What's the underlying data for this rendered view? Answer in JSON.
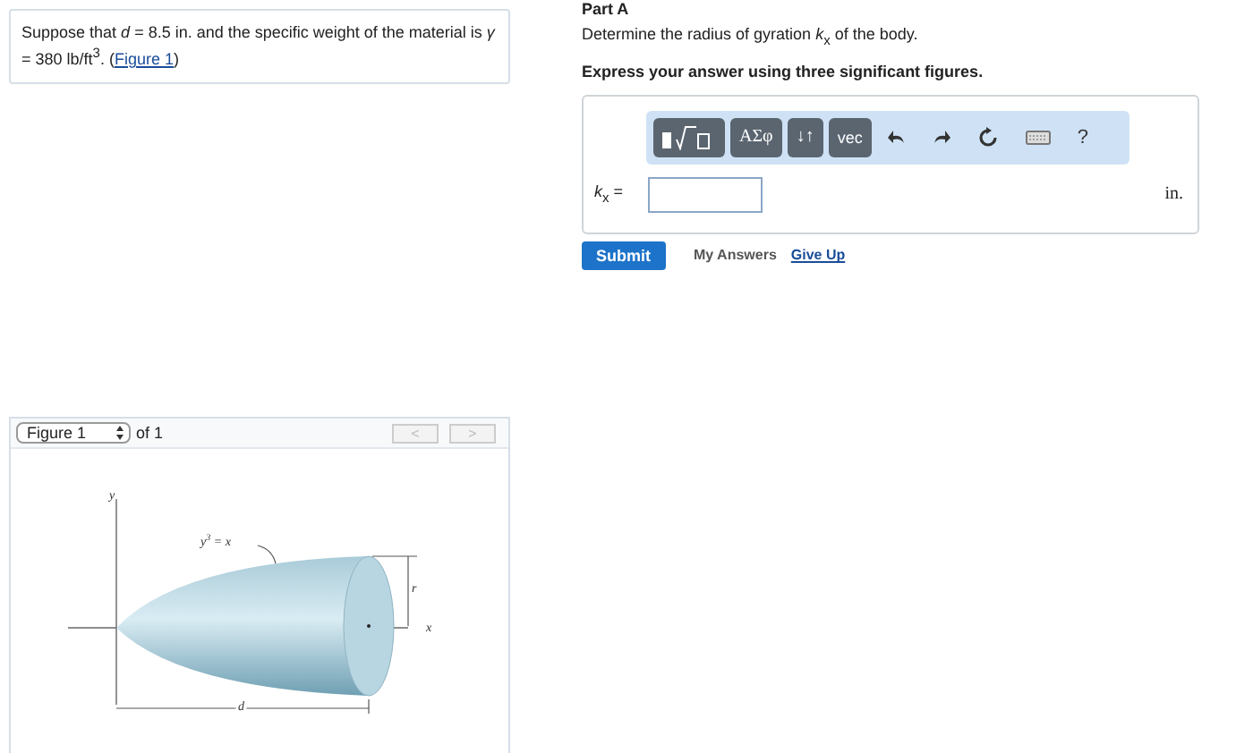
{
  "problem": {
    "lead": "Suppose that *d* = 8.5 in. and the specific weight of the material is *γ* = 380 lb/ft$^{3}$. (",
    "link": "Figure 1",
    "close": ")"
  },
  "figure_viewer": {
    "select": "Figure 1",
    "count": "of 1",
    "nav": [
      {
        "label": "<",
        "disabled": true
      },
      {
        "label": ">",
        "disabled": true
      }
    ],
    "labels": {
      "y_axis": "y",
      "curve": "y$^{3}$ = x",
      "radius": "r",
      "x_axis": "x",
      "length": "d"
    }
  },
  "part": {
    "title": "Part A",
    "question": "Determine the radius of gyration *k*$_{x}$ of the body.",
    "instruction": "Express your answer using three significant figures.",
    "toolbar": [
      {
        "kind": "templates"
      },
      {
        "kind": "text",
        "label": "ΑΣφ"
      },
      {
        "kind": "text",
        "label": "↓↑"
      },
      {
        "kind": "text",
        "label": "vec"
      },
      {
        "kind": "undo"
      },
      {
        "kind": "redo"
      },
      {
        "kind": "reset"
      },
      {
        "kind": "keyboard"
      },
      {
        "kind": "help",
        "label": "?"
      }
    ],
    "answer_label": "*k*$_{x}$ =",
    "unit": "in.",
    "submit": "Submit",
    "my_answers": "My Answers",
    "give_up": "Give Up"
  }
}
